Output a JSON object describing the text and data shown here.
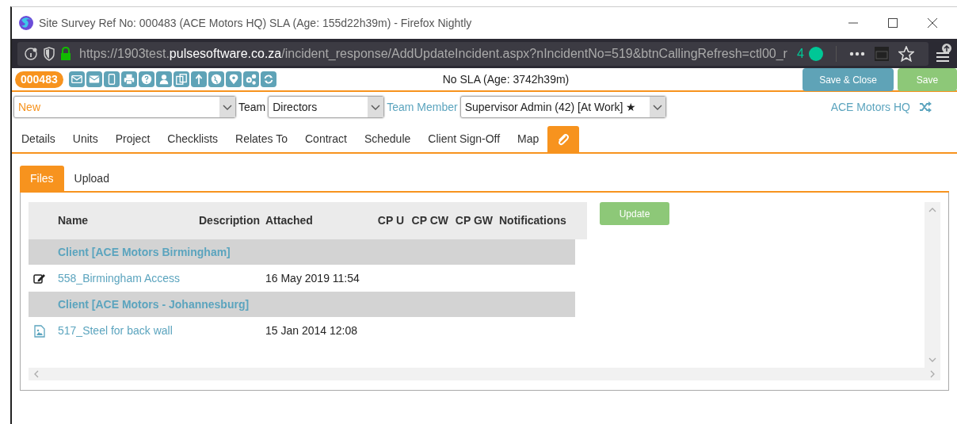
{
  "window": {
    "title": "Site Survey Ref No: 000483 (ACE Motors HQ) SLA (Age: 155d22h39m) - Firefox Nightly"
  },
  "browser": {
    "url": {
      "start": "https://1903test.",
      "domain": "pulsesoftware.co.za",
      "path": "/incident_response/AddUpdateIncident.aspx?nIncidentNo=519&btnCallingRefresh=ctl00_r"
    },
    "badge_count": "4"
  },
  "toolbar": {
    "reference": "000483",
    "sla": "No SLA (Age: 3742h39m)",
    "buttons": [
      {
        "label": "Save & Close",
        "kind": "secondary"
      },
      {
        "label": "Save",
        "kind": "primary"
      }
    ]
  },
  "assignment": {
    "status": "New",
    "team_label": "Team",
    "team": "Directors",
    "member_label": "Team Member",
    "member": "Supervisor Admin (42) [At Work] ★",
    "site": "ACE Motors HQ"
  },
  "tabs": [
    {
      "kind": "text",
      "label": "Details",
      "selected": false
    },
    {
      "kind": "text",
      "label": "Units",
      "selected": false
    },
    {
      "kind": "text",
      "label": "Project",
      "selected": false
    },
    {
      "kind": "text",
      "label": "Checklists",
      "selected": false
    },
    {
      "kind": "text",
      "label": "Relates To",
      "selected": false
    },
    {
      "kind": "text",
      "label": "Contract",
      "selected": false
    },
    {
      "kind": "text",
      "label": "Schedule",
      "selected": false
    },
    {
      "kind": "text",
      "label": "Client Sign-Off",
      "selected": false
    },
    {
      "kind": "text",
      "label": "Map",
      "selected": false
    },
    {
      "kind": "attachments",
      "selected": true
    }
  ],
  "subtabs": [
    {
      "label": "Files",
      "selected": true
    },
    {
      "label": "Upload",
      "selected": false
    }
  ],
  "files": {
    "columns": [
      "Name",
      "Description",
      "Attached",
      "CP U",
      "CP CW",
      "CP GW",
      "Notifications"
    ],
    "rows": [
      {
        "kind": "group",
        "name": "Client [ACE Motors Birmingham]"
      },
      {
        "kind": "note",
        "name": "558_Birmingham Access",
        "attached": "16 May 2019 11:54"
      },
      {
        "kind": "group",
        "name": "Client [ACE Motors - Johannesburg]"
      },
      {
        "kind": "image",
        "name": "517_Steel for back wall",
        "attached": "15 Jan 2014 12:08"
      }
    ],
    "update_button": "Update"
  }
}
